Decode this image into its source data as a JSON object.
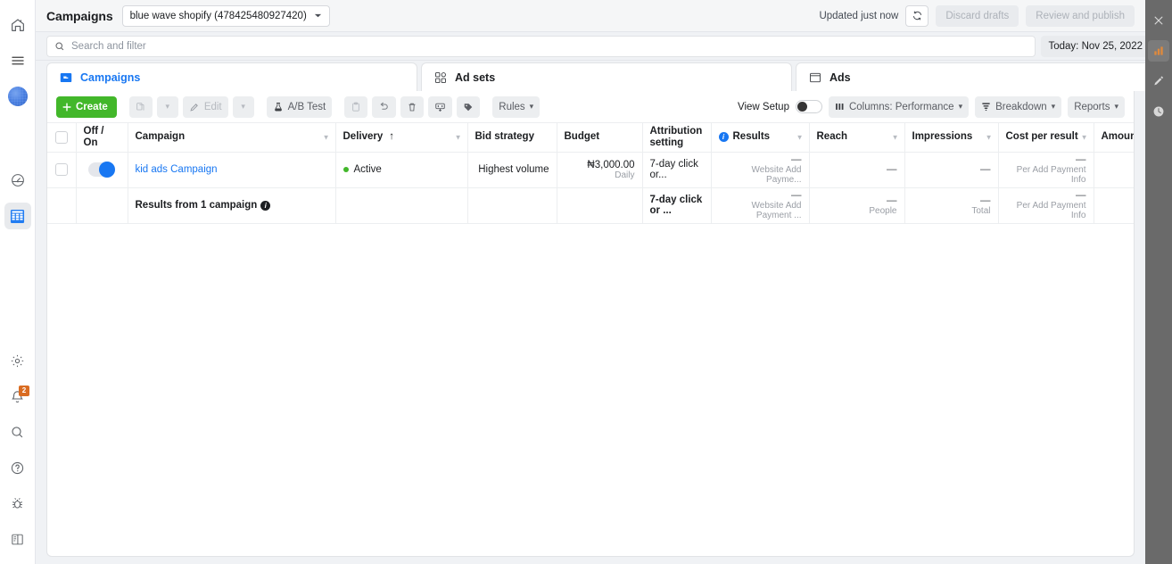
{
  "left_rail": {
    "items": [
      {
        "name": "home-icon",
        "label": "Home"
      },
      {
        "name": "menu-icon",
        "label": "All tools"
      },
      {
        "name": "account-avatar",
        "label": "Account"
      },
      {
        "name": "performance-icon",
        "label": "Performance"
      },
      {
        "name": "campaigns-grid-icon",
        "label": "Ads Manager",
        "selected": true
      }
    ],
    "bottom_items": [
      {
        "name": "settings-gear-icon",
        "label": "Settings"
      },
      {
        "name": "notifications-bell-icon",
        "label": "Notifications",
        "badge": "2"
      },
      {
        "name": "search-icon",
        "label": "Search"
      },
      {
        "name": "help-icon",
        "label": "Help"
      },
      {
        "name": "bug-report-icon",
        "label": "Report a bug"
      },
      {
        "name": "layout-panel-icon",
        "label": "Layout"
      }
    ]
  },
  "right_rail": {
    "items": [
      {
        "name": "close-icon",
        "label": "Close"
      },
      {
        "name": "bar-chart-icon",
        "label": "Charts",
        "selected": true
      },
      {
        "name": "pencil-icon",
        "label": "Edit"
      },
      {
        "name": "clock-icon",
        "label": "History"
      }
    ]
  },
  "topbar": {
    "title": "Campaigns",
    "account": "blue wave shopify (478425480927420)",
    "updated": "Updated just now",
    "refresh_icon": "refresh-icon",
    "discard_label": "Discard drafts",
    "publish_label": "Review and publish",
    "more_label": "•••"
  },
  "search": {
    "placeholder": "Search and filter",
    "value": "",
    "date_range": "Today: Nov 25, 2022"
  },
  "tabs": [
    {
      "label": "Campaigns",
      "icon": "campaigns-icon",
      "active": true
    },
    {
      "label": "Ad sets",
      "icon": "adsets-icon",
      "active": false
    },
    {
      "label": "Ads",
      "icon": "ads-icon",
      "active": false
    }
  ],
  "toolbar": {
    "create_label": "Create",
    "duplicate_icon": "duplicate-icon",
    "duplicate_caret": "▾",
    "edit_label": "Edit",
    "edit_caret": "▾",
    "abtest_label": "A/B Test",
    "clipboard_icon": "clipboard-icon",
    "undo_icon": "undo-icon",
    "delete_icon": "trash-icon",
    "automated_rules_icon": "automated-rules-icon",
    "tag_icon": "tag-icon",
    "rules_label": "Rules",
    "rules_caret": "▾",
    "view_setup_label": "View Setup",
    "columns_label": "Columns: Performance",
    "columns_caret": "▾",
    "breakdown_label": "Breakdown",
    "breakdown_caret": "▾",
    "reports_label": "Reports",
    "reports_caret": "▾"
  },
  "table": {
    "columns": [
      {
        "id": "check",
        "label": ""
      },
      {
        "id": "offon",
        "label": "Off / On"
      },
      {
        "id": "campaign",
        "label": "Campaign",
        "caret": true
      },
      {
        "id": "delivery",
        "label": "Delivery",
        "sort": "↑",
        "caret": true,
        "blue": true
      },
      {
        "id": "bid",
        "label": "Bid strategy"
      },
      {
        "id": "budget",
        "label": "Budget"
      },
      {
        "id": "attribution",
        "label": "Attribution setting",
        "center": true
      },
      {
        "id": "results",
        "label": "Results",
        "info": true,
        "caret": true
      },
      {
        "id": "reach",
        "label": "Reach",
        "caret": true
      },
      {
        "id": "impressions",
        "label": "Impressions",
        "caret": true
      },
      {
        "id": "cpr",
        "label": "Cost per result",
        "caret": true
      },
      {
        "id": "spent",
        "label": "Amount sp"
      }
    ],
    "rows": [
      {
        "campaign": "kid ads Campaign",
        "delivery": "Active",
        "bid_strategy": "Highest volume",
        "budget": "₦3,000.00",
        "budget_sub": "Daily",
        "attribution": "7-day click or...",
        "results": "—",
        "results_sub": "Website Add Payme...",
        "reach": "—",
        "reach_sub": "",
        "impressions": "—",
        "impressions_sub": "",
        "cpr": "—",
        "cpr_sub": "Per Add Payment Info",
        "spent": ""
      }
    ],
    "total_row": {
      "label": "Results from 1 campaign",
      "attribution": "7-day click or ...",
      "results": "—",
      "results_sub": "Website Add Payment ...",
      "reach": "—",
      "reach_sub": "People",
      "impressions": "—",
      "impressions_sub": "Total",
      "cpr": "—",
      "cpr_sub": "Per Add Payment Info",
      "spent": ""
    }
  },
  "colors": {
    "brand_blue": "#1877f2",
    "create_green": "#42b72a",
    "active_green": "#42b72a",
    "badge_orange": "#d96c22",
    "rail_gray": "#6a6a6a"
  }
}
